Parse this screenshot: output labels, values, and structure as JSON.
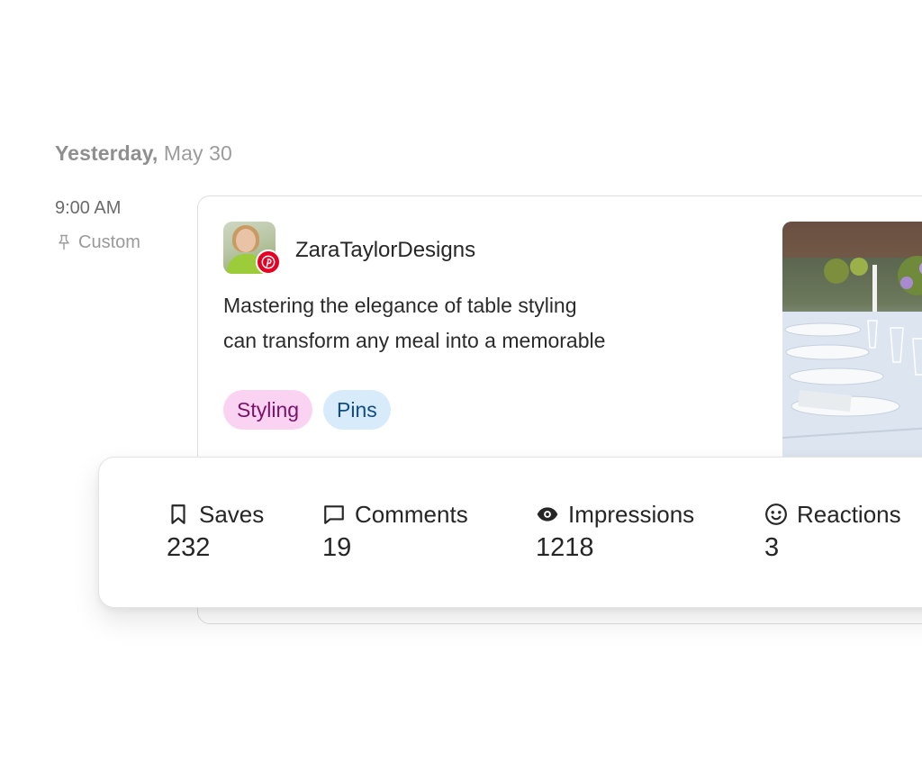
{
  "date_heading": {
    "day": "Yesterday,",
    "date": "May 30"
  },
  "schedule": {
    "time": "9:00 AM",
    "type_label": "Custom",
    "type_icon": "pin-icon"
  },
  "post": {
    "network": "Pinterest",
    "network_color": "#e60023",
    "username": "ZaraTaylorDesigns",
    "text_lines": [
      "Mastering the elegance of table styling",
      "can transform any meal into a memorable"
    ],
    "tags": [
      {
        "label": "Styling",
        "bg": "#fbd3f2",
        "fg": "#7a1367"
      },
      {
        "label": "Pins",
        "bg": "#d7ebfb",
        "fg": "#104d84"
      }
    ]
  },
  "stats": [
    {
      "icon": "bookmark-icon",
      "label": "Saves",
      "value": "232"
    },
    {
      "icon": "comment-icon",
      "label": "Comments",
      "value": "19"
    },
    {
      "icon": "eye-icon",
      "label": "Impressions",
      "value": "1218"
    },
    {
      "icon": "smiley-icon",
      "label": "Reactions",
      "value": "3"
    }
  ]
}
